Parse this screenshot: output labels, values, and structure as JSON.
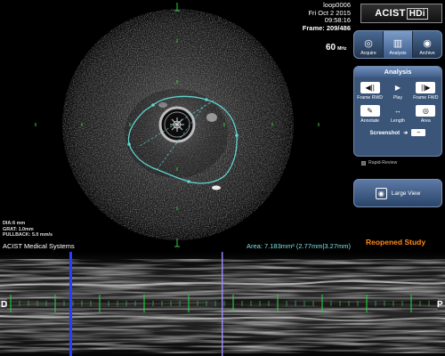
{
  "frame_info": {
    "loop": "loop0006",
    "date": "Fri Oct 2 2015",
    "time": "09:58:16",
    "frame": "Frame: 209/486"
  },
  "transducer": {
    "frequency": "60",
    "unit": "MHz"
  },
  "logo": {
    "brand": "ACIST",
    "product": "HDi"
  },
  "modes": [
    {
      "label": "Acquire",
      "icon": "acquire-icon"
    },
    {
      "label": "Analysis",
      "icon": "analysis-icon",
      "active": true
    },
    {
      "label": "Archive",
      "icon": "archive-icon"
    }
  ],
  "analysis": {
    "title": "Analysis",
    "tools": [
      {
        "label": "Frame RWD",
        "glyph": "◀||",
        "icon": "frame-rewind-icon"
      },
      {
        "label": "Play",
        "glyph": "▶",
        "icon": "play-icon"
      },
      {
        "label": "Frame FWD",
        "glyph": "||▶",
        "icon": "frame-forward-icon"
      },
      {
        "label": "Annotate",
        "glyph": "✎",
        "icon": "annotate-icon"
      },
      {
        "label": "Length",
        "glyph": "↔",
        "icon": "length-icon"
      },
      {
        "label": "Area",
        "glyph": "◎",
        "icon": "area-icon"
      }
    ],
    "screenshot_label": "Screenshot",
    "usb_glyph": "⇔"
  },
  "rapid_review": {
    "label": "Rapid-Review"
  },
  "large_view": {
    "label": "Large View"
  },
  "image_params": {
    "dia": "DIA:6 mm",
    "grat": "GRAT: 1.0mm",
    "pullback": "PULLBACK: 5.0 mm/s"
  },
  "company": "ACIST Medical Systems",
  "area_readout": "Area:  7.183mm² (2.77mm|3.27mm)",
  "status": "Reopened Study",
  "longitudinal": {
    "left_label": "D",
    "right_label": "P"
  },
  "colors": {
    "contour": "#5fd4d0",
    "marker_green": "#2ecc40",
    "cursor_blue": "#2a3cff",
    "cursor_lilac": "#9a8cff",
    "status_orange": "#ff8a1a",
    "panel_blue": "#3a5578"
  }
}
